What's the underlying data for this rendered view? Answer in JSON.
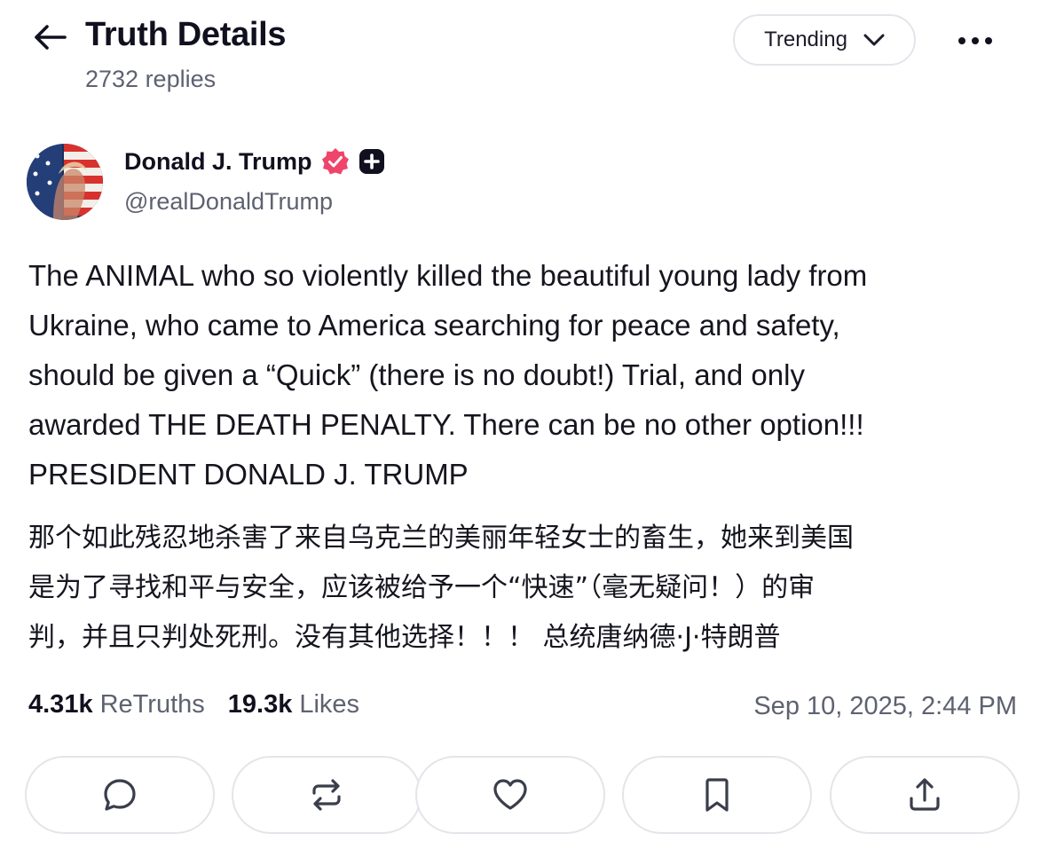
{
  "header": {
    "title": "Truth Details",
    "reply_count": "2732 replies",
    "sort_label": "Trending"
  },
  "post": {
    "author": {
      "display_name": "Donald J. Trump",
      "handle": "@realDonaldTrump",
      "verified_color": "#f0456a"
    },
    "body_lines": [
      "The ANIMAL who so violently killed the beautiful young lady from",
      "Ukraine, who came to America searching for peace and safety,",
      "should be given a “Quick” (there is no doubt!) Trial, and only",
      "awarded THE DEATH PENALTY. There can be no other option!!!",
      "PRESIDENT DONALD J. TRUMP"
    ],
    "translation_lines": [
      "那个如此残忍地杀害了来自乌克兰的美丽年轻女士的畜生，她来到美国",
      "是为了寻找和平与安全，应该被给予一个“快速”（毫无疑问！）的审",
      "判，并且只判处死刑。没有其他选择！！！ 总统唐纳德·J·特朗普"
    ],
    "stats": {
      "retruths_count": "4.31k",
      "retruths_label": "ReTruths",
      "likes_count": "19.3k",
      "likes_label": "Likes"
    },
    "timestamp": "Sep 10, 2025, 2:44 PM"
  },
  "actions": [
    {
      "icon": "reply-icon"
    },
    {
      "icon": "retruth-icon"
    },
    {
      "icon": "heart-icon"
    },
    {
      "icon": "bookmark-icon"
    },
    {
      "icon": "share-icon"
    }
  ]
}
